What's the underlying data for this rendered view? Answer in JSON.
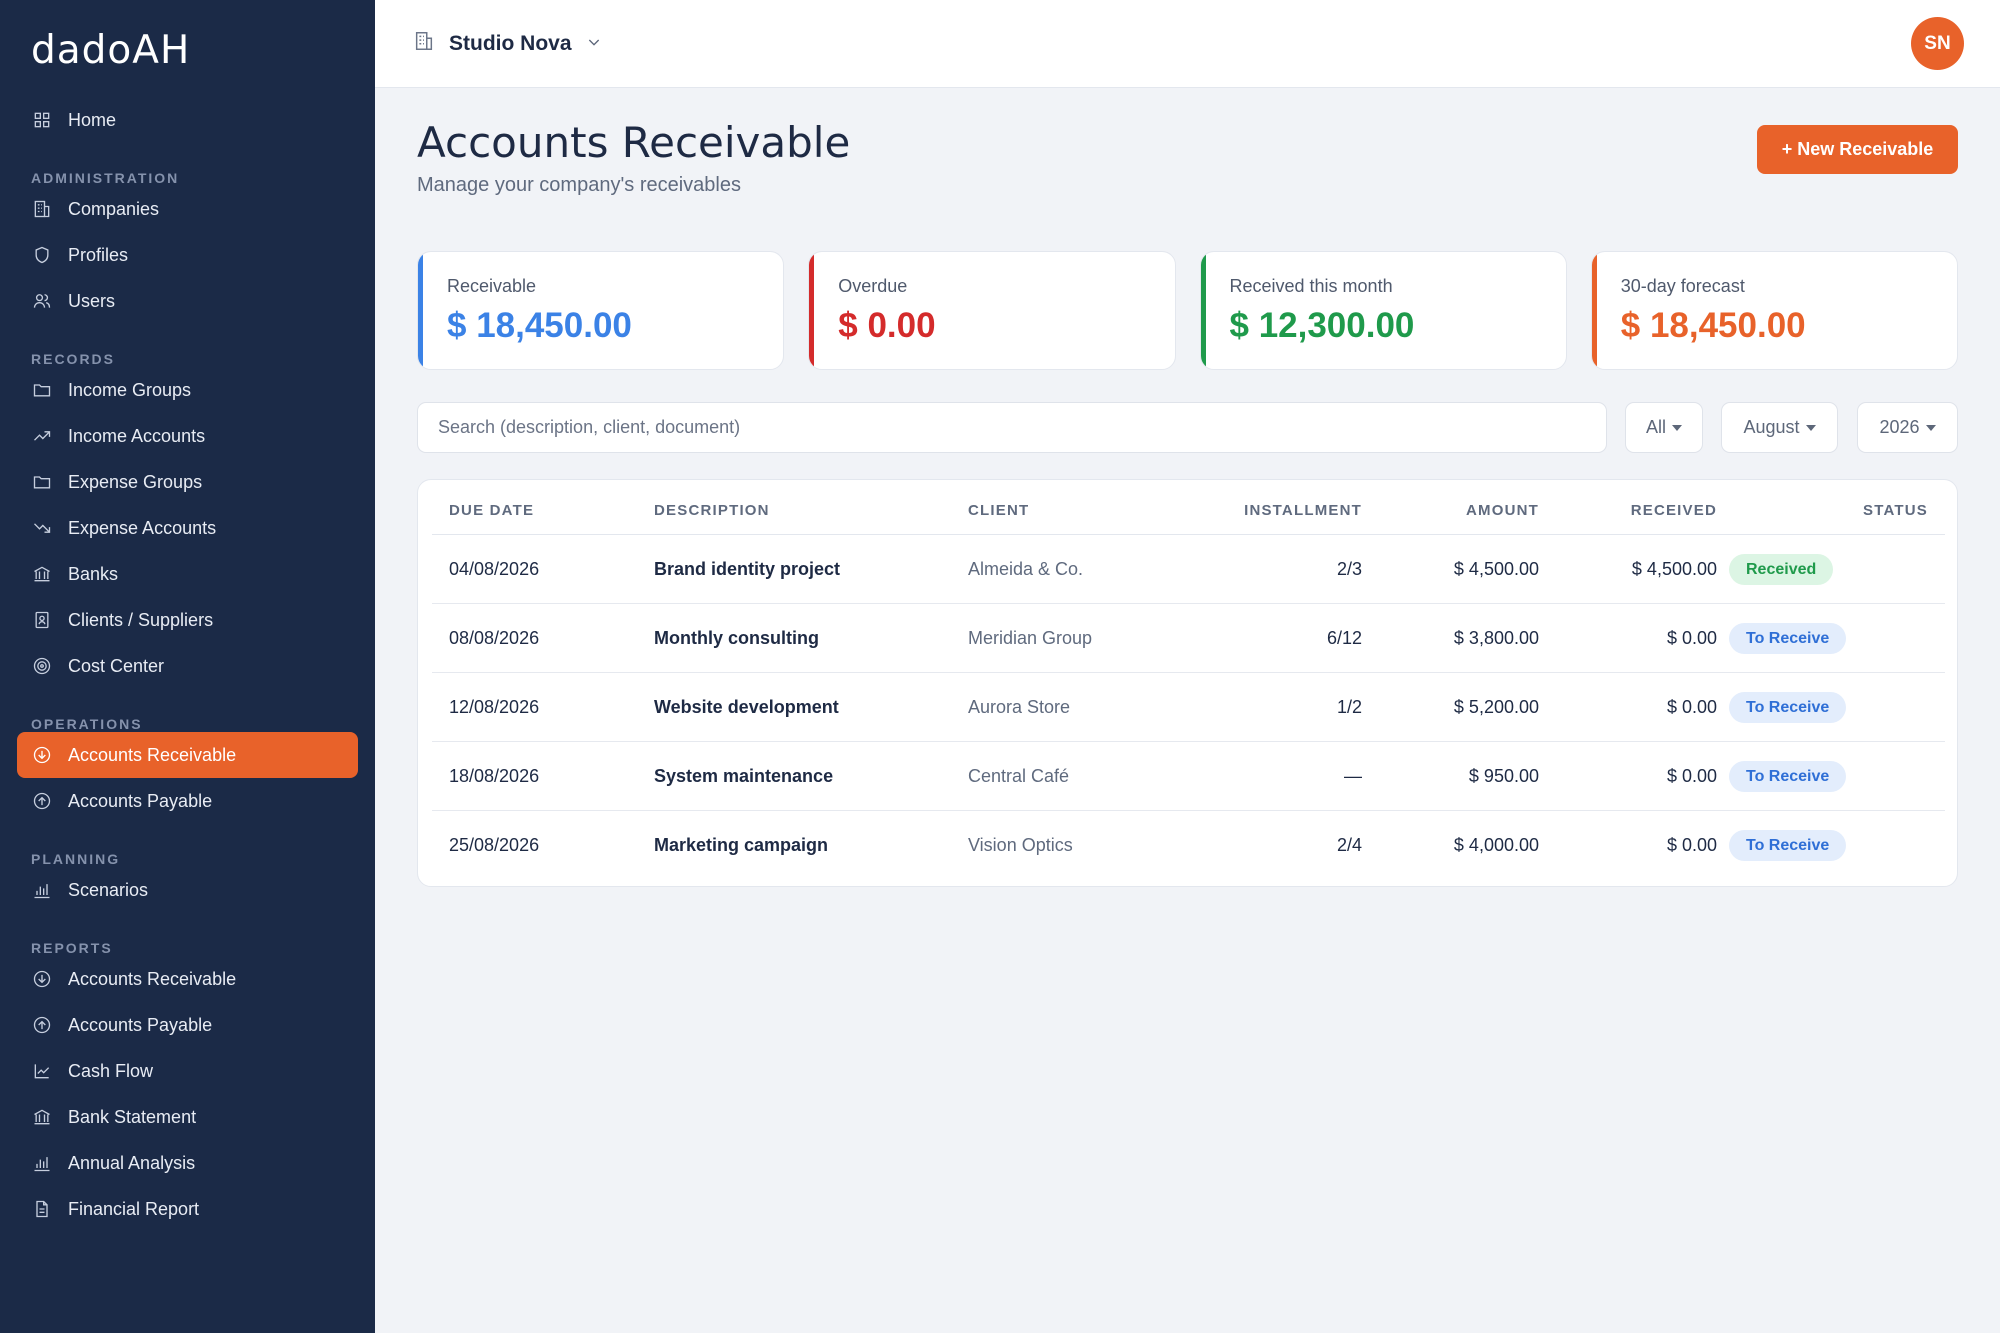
{
  "app": {
    "logo": "dadoAH"
  },
  "sidebar": {
    "home": {
      "label": "Home",
      "icon": "home-grid-icon"
    },
    "sections": [
      {
        "title": "ADMINISTRATION",
        "items": [
          {
            "label": "Companies",
            "icon": "building-icon"
          },
          {
            "label": "Profiles",
            "icon": "shield-icon"
          },
          {
            "label": "Users",
            "icon": "users-icon"
          }
        ]
      },
      {
        "title": "RECORDS",
        "items": [
          {
            "label": "Income Groups",
            "icon": "folder-icon"
          },
          {
            "label": "Income Accounts",
            "icon": "trend-up-icon"
          },
          {
            "label": "Expense Groups",
            "icon": "folder-icon"
          },
          {
            "label": "Expense Accounts",
            "icon": "trend-down-icon"
          },
          {
            "label": "Banks",
            "icon": "bank-icon"
          },
          {
            "label": "Clients / Suppliers",
            "icon": "contact-card-icon"
          },
          {
            "label": "Cost Center",
            "icon": "target-icon"
          }
        ]
      },
      {
        "title": "OPERATIONS",
        "items": [
          {
            "label": "Accounts Receivable",
            "icon": "arrow-down-circle-icon",
            "active": true
          },
          {
            "label": "Accounts Payable",
            "icon": "arrow-up-circle-icon"
          }
        ]
      },
      {
        "title": "PLANNING",
        "items": [
          {
            "label": "Scenarios",
            "icon": "bar-chart-icon"
          }
        ]
      },
      {
        "title": "REPORTS",
        "items": [
          {
            "label": "Accounts Receivable",
            "icon": "arrow-down-circle-icon"
          },
          {
            "label": "Accounts Payable",
            "icon": "arrow-up-circle-icon"
          },
          {
            "label": "Cash Flow",
            "icon": "line-chart-icon"
          },
          {
            "label": "Bank Statement",
            "icon": "bank-icon"
          },
          {
            "label": "Annual Analysis",
            "icon": "bar-chart-icon"
          },
          {
            "label": "Financial Report",
            "icon": "document-icon"
          }
        ]
      }
    ]
  },
  "topbar": {
    "company": "Studio Nova",
    "avatar_initials": "SN"
  },
  "header": {
    "title": "Accounts Receivable",
    "subtitle": "Manage your company's receivables",
    "new_button": "+ New Receivable"
  },
  "cards": [
    {
      "label": "Receivable",
      "value": "$ 18,450.00",
      "color": "#3b82e6"
    },
    {
      "label": "Overdue",
      "value": "$ 0.00",
      "color": "#d42b2b"
    },
    {
      "label": "Received this month",
      "value": "$ 12,300.00",
      "color": "#1f9a4b"
    },
    {
      "label": "30-day forecast",
      "value": "$ 18,450.00",
      "color": "#e8622a"
    }
  ],
  "filters": {
    "search_placeholder": "Search (description, client, document)",
    "status": "All",
    "month": "August",
    "year": "2026"
  },
  "table": {
    "headers": {
      "due_date": "DUE DATE",
      "description": "DESCRIPTION",
      "client": "CLIENT",
      "installment": "INSTALLMENT",
      "amount": "AMOUNT",
      "received": "RECEIVED",
      "status": "STATUS"
    },
    "rows": [
      {
        "due_date": "04/08/2026",
        "description": "Brand identity project",
        "client": "Almeida & Co.",
        "installment": "2/3",
        "amount": "$ 4,500.00",
        "received": "$ 4,500.00",
        "status": "Received",
        "status_kind": "received"
      },
      {
        "due_date": "08/08/2026",
        "description": "Monthly consulting",
        "client": "Meridian Group",
        "installment": "6/12",
        "amount": "$ 3,800.00",
        "received": "$ 0.00",
        "status": "To Receive",
        "status_kind": "pending"
      },
      {
        "due_date": "12/08/2026",
        "description": "Website development",
        "client": "Aurora Store",
        "installment": "1/2",
        "amount": "$ 5,200.00",
        "received": "$ 0.00",
        "status": "To Receive",
        "status_kind": "pending"
      },
      {
        "due_date": "18/08/2026",
        "description": "System maintenance",
        "client": "Central Café",
        "installment": "—",
        "amount": "$ 950.00",
        "received": "$ 0.00",
        "status": "To Receive",
        "status_kind": "pending"
      },
      {
        "due_date": "25/08/2026",
        "description": "Marketing campaign",
        "client": "Vision Optics",
        "installment": "2/4",
        "amount": "$ 4,000.00",
        "received": "$ 0.00",
        "status": "To Receive",
        "status_kind": "pending"
      }
    ]
  },
  "colors": {
    "accent": "#e8622a",
    "sidebar_bg": "#1b2a47",
    "received_bg": "#dcf5e4",
    "received_fg": "#1f9a4b",
    "pending_bg": "#e3edfc",
    "pending_fg": "#2f6fd6"
  }
}
